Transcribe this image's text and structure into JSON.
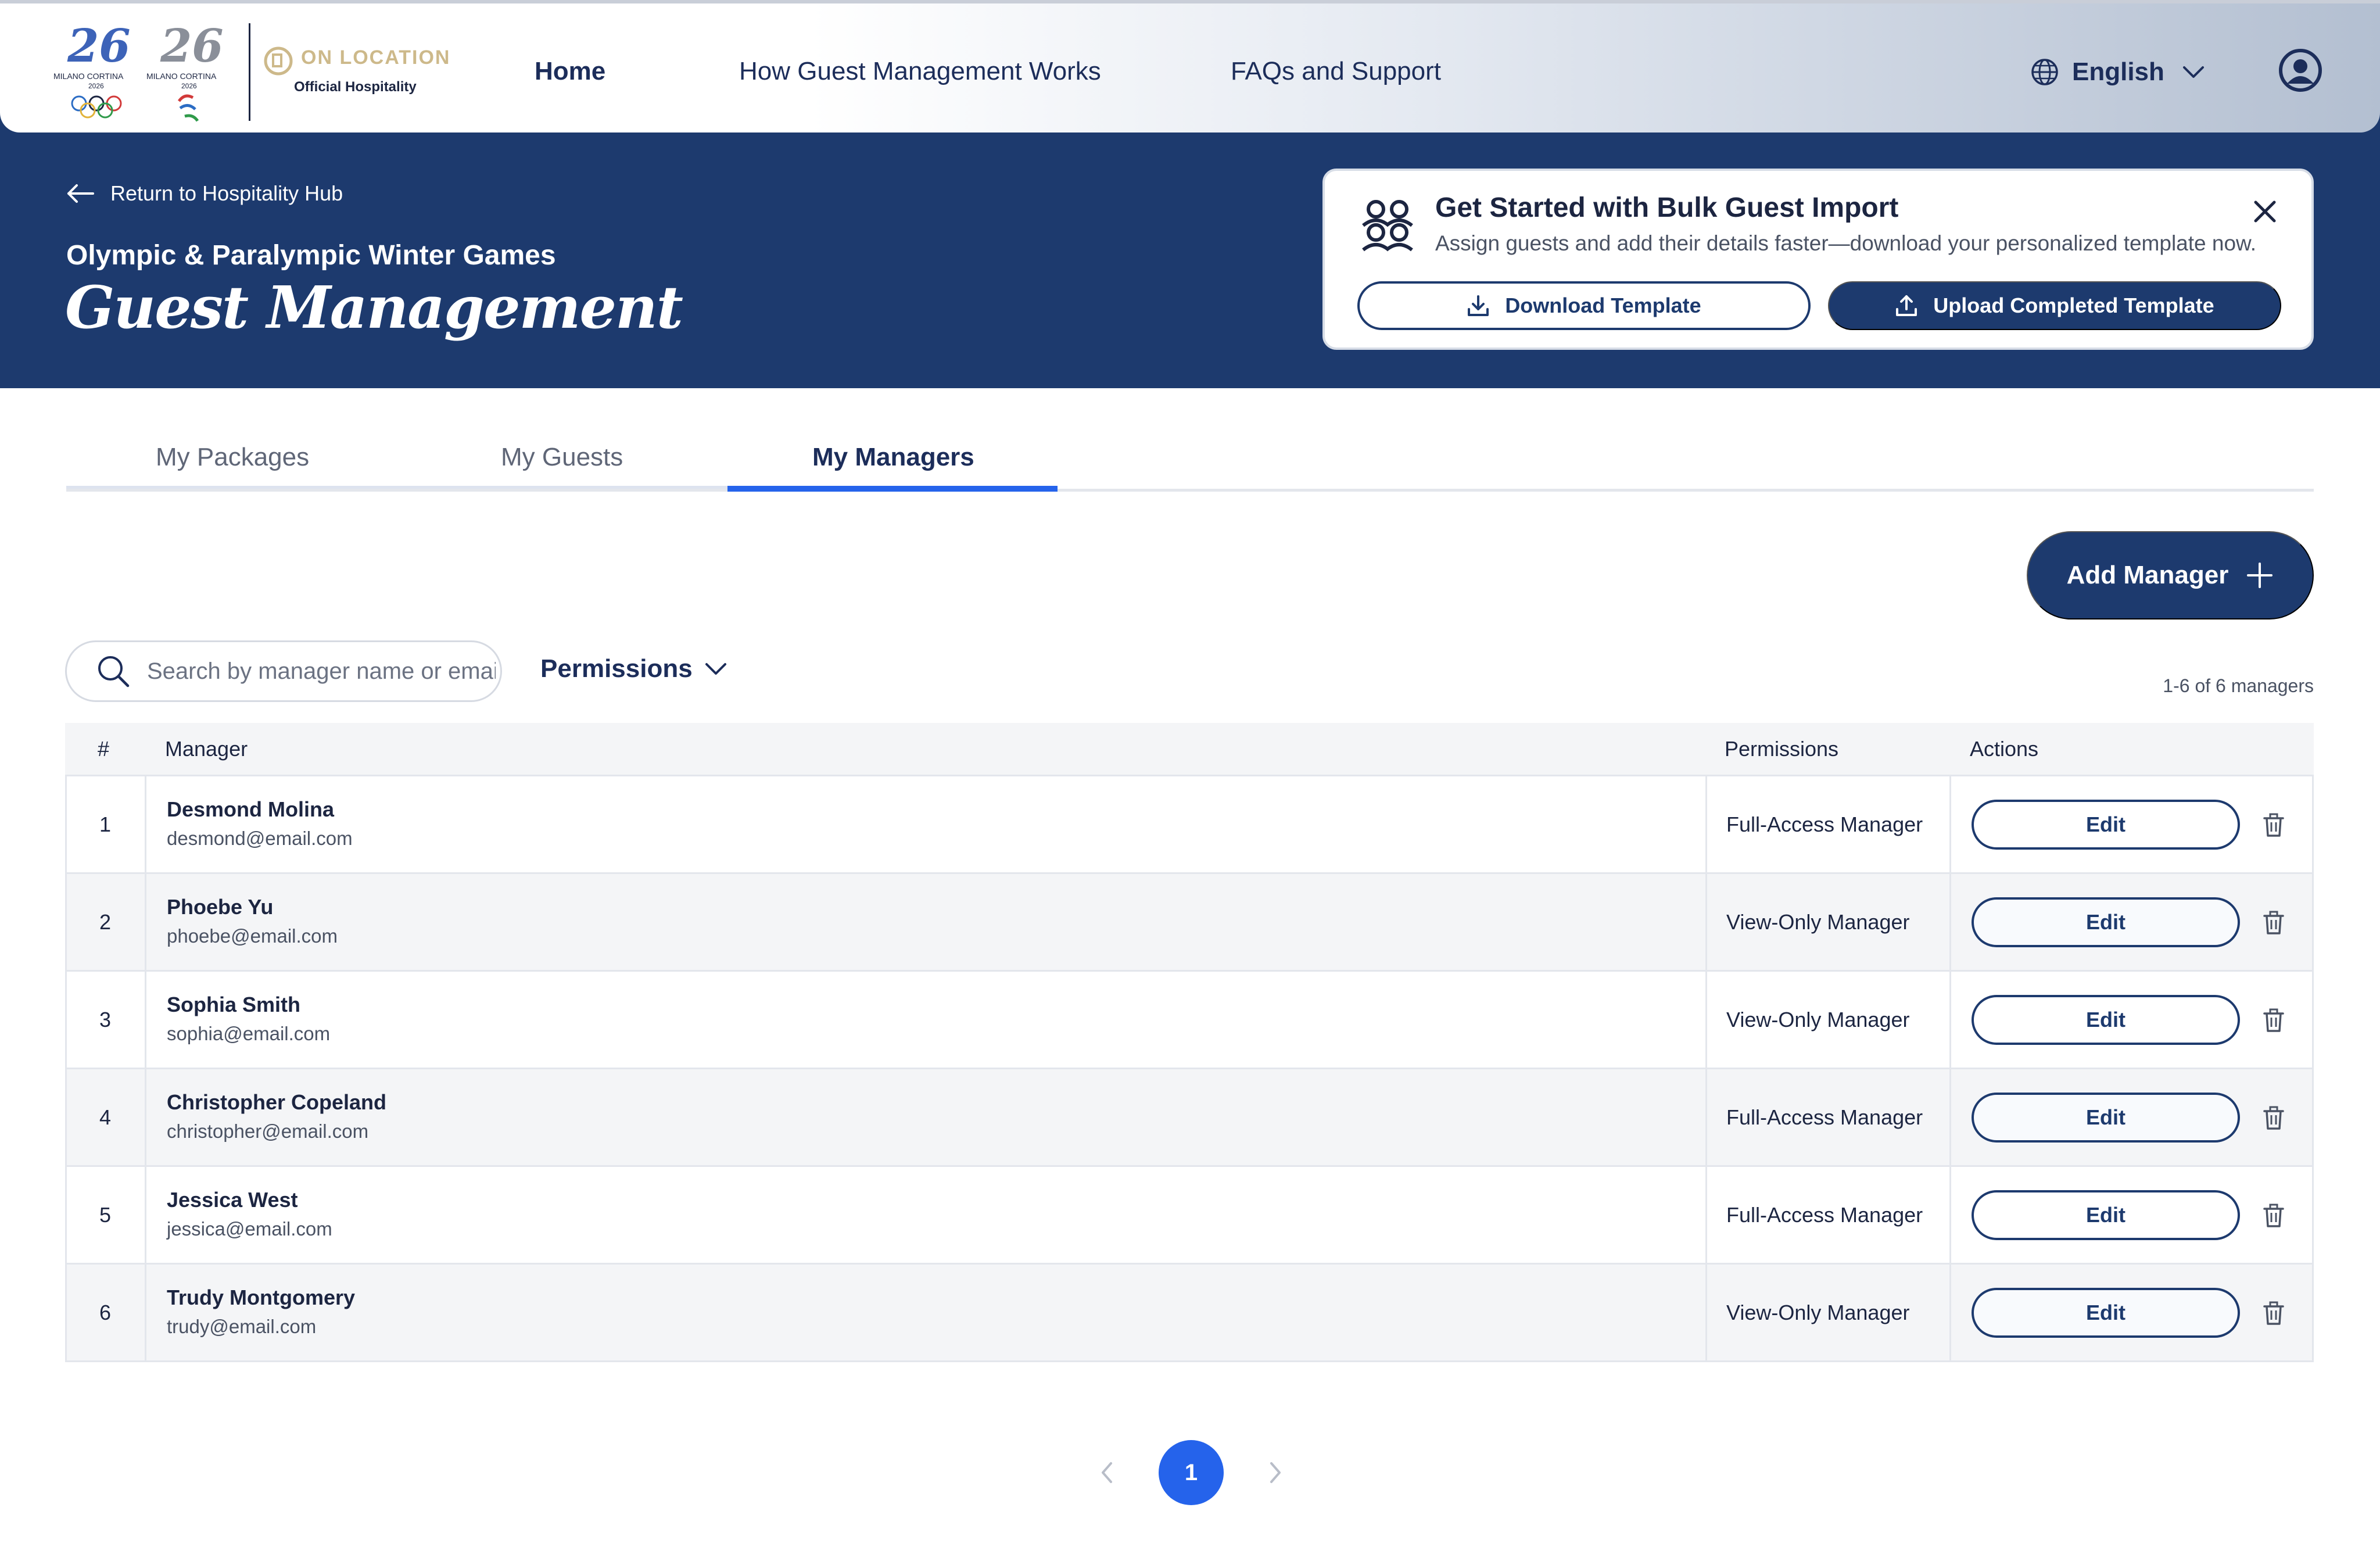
{
  "header": {
    "games_logo_text": "MILANO CORTINA 2026",
    "brand_title": "ON LOCATION",
    "brand_subtitle": "Official Hospitality",
    "nav": {
      "home": "Home",
      "how": "How Guest Management Works",
      "faq": "FAQs and Support"
    },
    "language": "English"
  },
  "hero": {
    "back_label": "Return to Hospitality Hub",
    "event_name": "Olympic & Paralympic Winter Games",
    "page_title": "Guest Management"
  },
  "import_card": {
    "title": "Get Started with Bulk Guest Import",
    "description": "Assign guests and add their details faster—download your personalized template now.",
    "download_label": "Download Template",
    "upload_label": "Upload Completed Template"
  },
  "tabs": {
    "packages": "My Packages",
    "guests": "My Guests",
    "managers": "My Managers",
    "active": "My Managers"
  },
  "actions": {
    "add_manager": "Add Manager"
  },
  "filters": {
    "search_placeholder": "Search by manager name or email",
    "permissions_label": "Permissions",
    "count_text": "1-6 of 6 managers"
  },
  "table": {
    "headers": {
      "num": "#",
      "manager": "Manager",
      "permissions": "Permissions",
      "actions": "Actions"
    },
    "edit_label": "Edit",
    "rows": [
      {
        "num": "1",
        "name": "Desmond Molina",
        "email": "desmond@email.com",
        "permission": "Full-Access Manager"
      },
      {
        "num": "2",
        "name": "Phoebe Yu",
        "email": "phoebe@email.com",
        "permission": "View-Only Manager"
      },
      {
        "num": "3",
        "name": "Sophia Smith",
        "email": "sophia@email.com",
        "permission": "View-Only Manager"
      },
      {
        "num": "4",
        "name": "Christopher Copeland",
        "email": "christopher@email.com",
        "permission": "Full-Access Manager"
      },
      {
        "num": "5",
        "name": "Jessica West",
        "email": "jessica@email.com",
        "permission": "Full-Access Manager"
      },
      {
        "num": "6",
        "name": "Trudy Montgomery",
        "email": "trudy@email.com",
        "permission": "View-Only Manager"
      }
    ]
  },
  "pagination": {
    "current_page": "1"
  },
  "colors": {
    "navy": "#1d3a6e",
    "accent_blue": "#2563eb",
    "brand_gold": "#cdb98a",
    "row_alt": "#f4f5f7"
  },
  "icons": {
    "back": "arrow-left-icon",
    "language": "globe-icon",
    "language_caret": "chevron-down-icon",
    "account": "user-circle-icon",
    "import": "people-group-icon",
    "close": "close-icon",
    "download": "download-icon",
    "upload": "upload-icon",
    "add": "plus-icon",
    "search": "search-icon",
    "filter_caret": "chevron-down-icon",
    "delete": "trash-icon",
    "prev": "chevron-left-icon",
    "next": "chevron-right-icon"
  }
}
